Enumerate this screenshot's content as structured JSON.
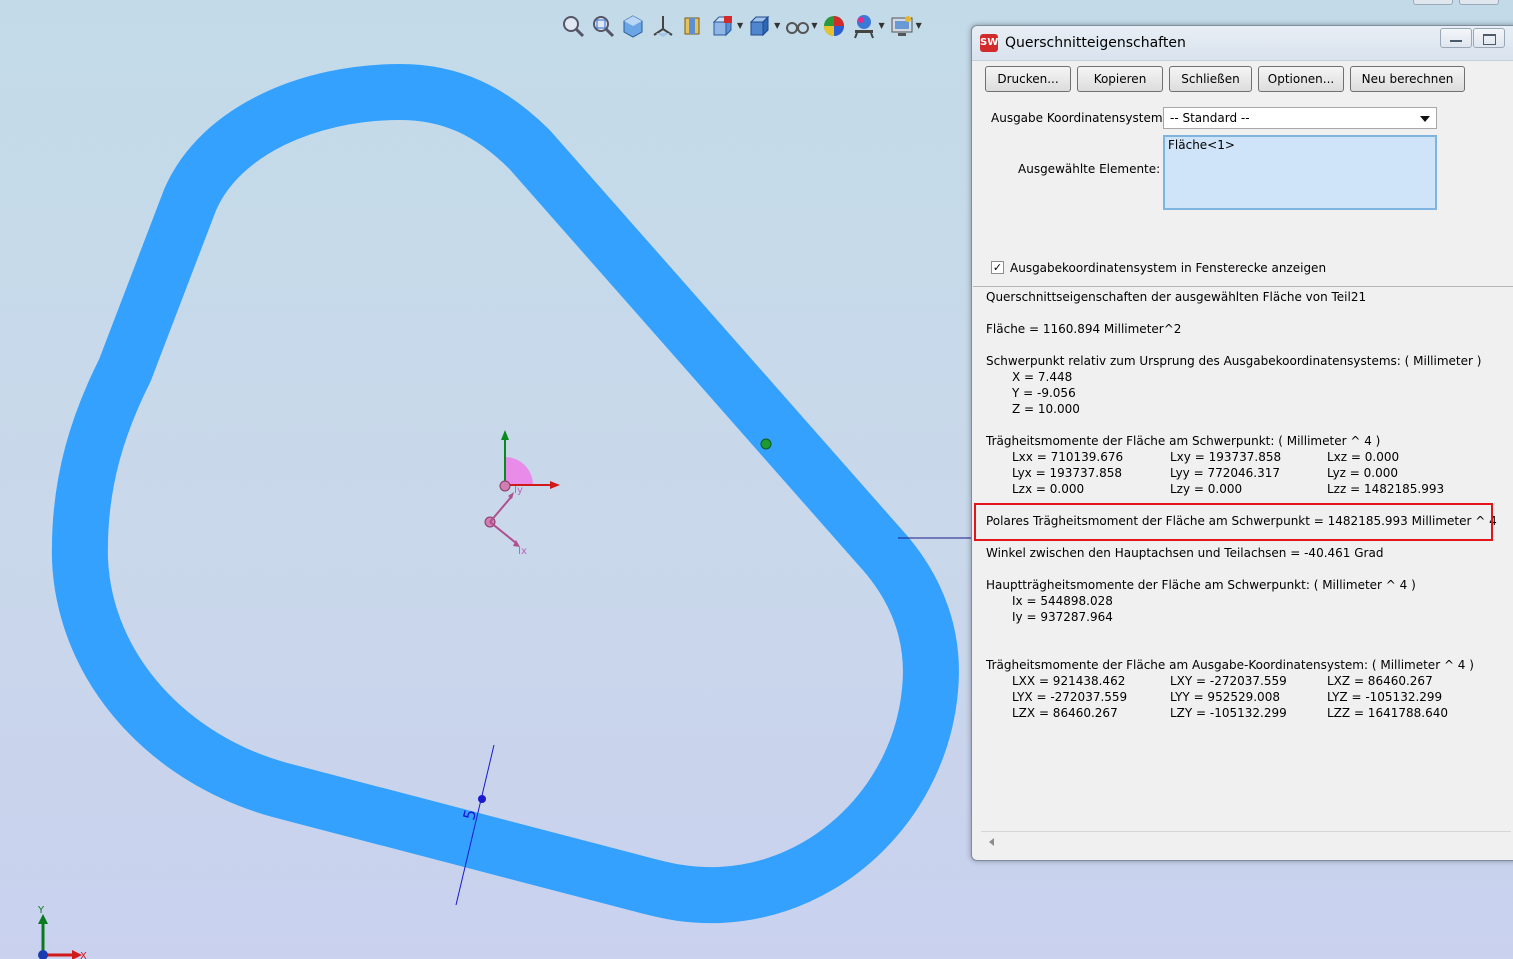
{
  "viewport": {
    "dimension_label": "5",
    "triad_x_label": "X",
    "triad_y_label": "Y",
    "centroid_ix_label": "Ix",
    "centroid_iy_label": "Iy",
    "profile_color": "#33a1fd",
    "background_color": "#c6d7ea"
  },
  "toolbar": {
    "icons": [
      "zoom-to-fit-icon",
      "zoom-area-icon",
      "view-orientation-icon",
      "standard-views-icon",
      "section-view-icon",
      "display-style-icon",
      "hide-show-icon",
      "view-settings-icon",
      "appearance-icon",
      "scene-icon",
      "display-manager-icon"
    ]
  },
  "dialog": {
    "title": "Querschnitteigenschaften",
    "buttons": {
      "print": "Drucken...",
      "copy": "Kopieren",
      "close": "Schließen",
      "options": "Optionen...",
      "recalc": "Neu berechnen"
    },
    "coord_label": "Ausgabe Koordinatensystem:",
    "coord_value": "-- Standard --",
    "selected_label": "Ausgewählte Elemente:",
    "selected_items": [
      "Fläche<1>"
    ],
    "show_coords_checkbox": {
      "label": "Ausgabekoordinatensystem in Fensterecke anzeigen",
      "checked": true
    },
    "results": {
      "heading": "Querschnittseigenschaften der ausgewählten Fläche von Teil21",
      "area": "Fläche = 1160.894 Millimeter^2",
      "centroid_heading": "Schwerpunkt relativ zum Ursprung des Ausgabekoordinatensystems: ( Millimeter )",
      "centroid": [
        "X = 7.448",
        "Y = -9.056",
        "Z = 10.000"
      ],
      "moments_centroid_heading": "Trägheitsmomente der Fläche am Schwerpunkt: ( Millimeter ^ 4 )",
      "moments_centroid": [
        [
          "Lxx = 710139.676",
          "Lxy = 193737.858",
          "Lxz = 0.000"
        ],
        [
          "Lyx = 193737.858",
          "Lyy = 772046.317",
          "Lyz = 0.000"
        ],
        [
          "Lzx = 0.000",
          "Lzy = 0.000",
          "Lzz = 1482185.993"
        ]
      ],
      "polar_moment": "Polares Trägheitsmoment der Fläche am Schwerpunkt  = 1482185.993 Millimeter ^ 4",
      "angle": "Winkel zwischen den Hauptachsen und Teilachsen = -40.461 Grad",
      "principal_heading": "Hauptträgheitsmomente der Fläche am Schwerpunkt: ( Millimeter ^ 4 )",
      "principal": [
        "Ix = 544898.028",
        "Iy = 937287.964"
      ],
      "moments_output_heading": "Trägheitsmomente der Fläche am Ausgabe-Koordinatensystem: ( Millimeter ^ 4 )",
      "moments_output": [
        [
          "LXX = 921438.462",
          "LXY = -272037.559",
          "LXZ = 86460.267"
        ],
        [
          "LYX = -272037.559",
          "LYY = 952529.008",
          "LYZ = -105132.299"
        ],
        [
          "LZX = 86460.267",
          "LZY = -105132.299",
          "LZZ = 1641788.640"
        ]
      ]
    },
    "highlight_color": "#e3141a"
  }
}
